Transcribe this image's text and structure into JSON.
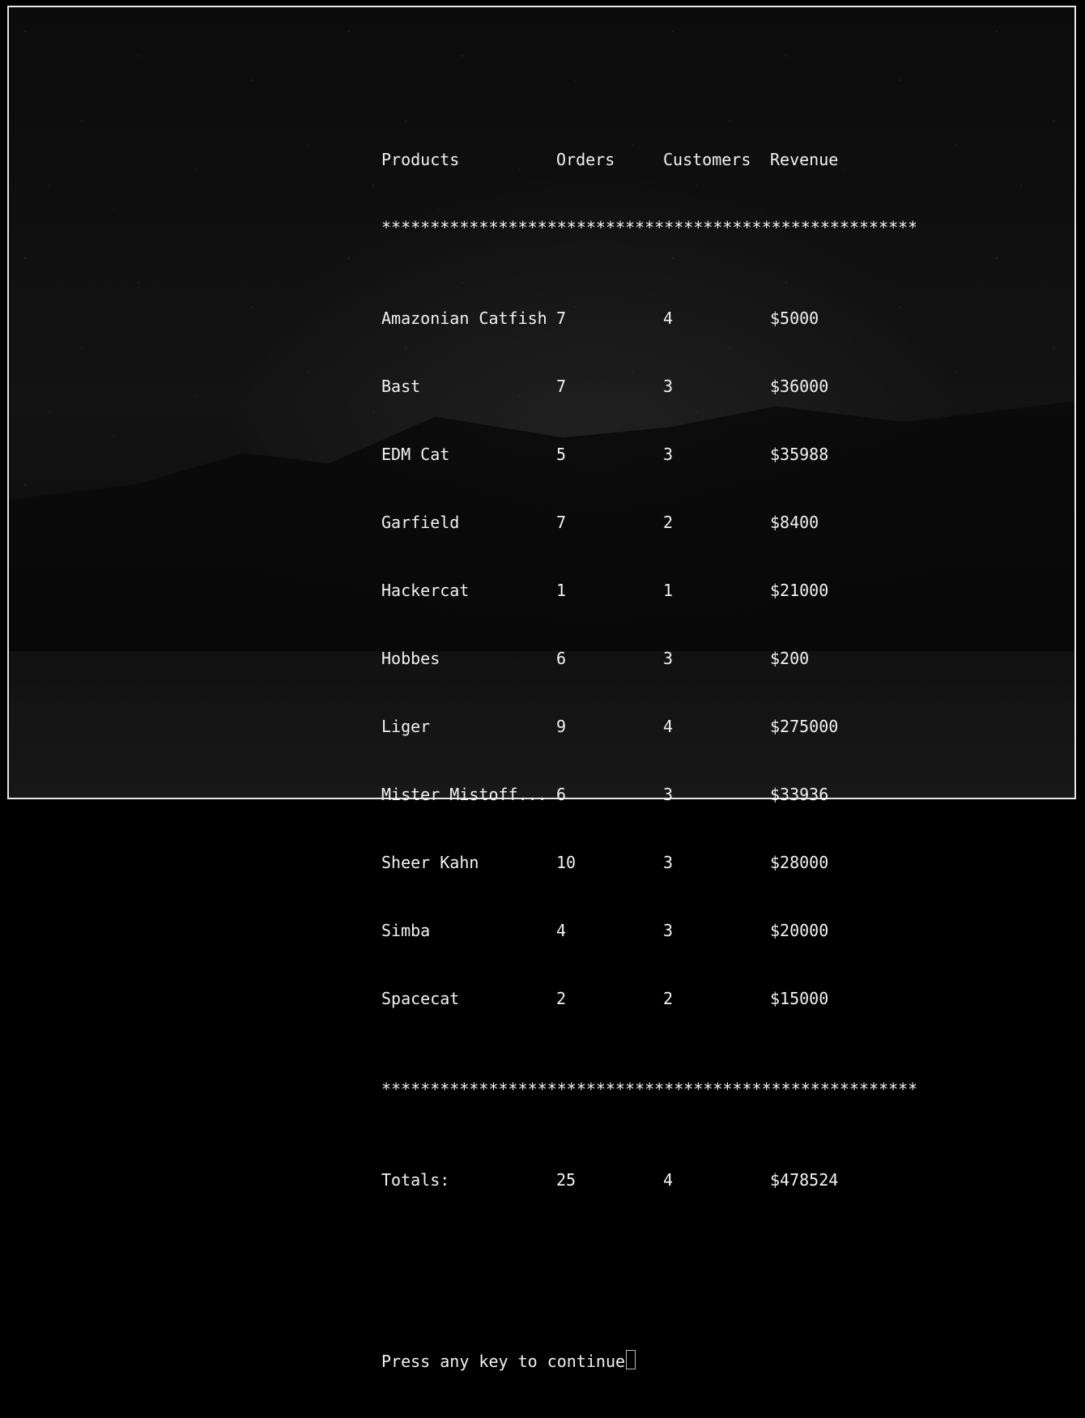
{
  "table": {
    "headers": [
      "Products",
      "Orders",
      "Customers",
      "Revenue"
    ],
    "separator": "*******************************************************",
    "rows": [
      {
        "product": "Amazonian Catfish",
        "orders": "7",
        "customers": "4",
        "revenue": "$5000"
      },
      {
        "product": "Bast",
        "orders": "7",
        "customers": "3",
        "revenue": "$36000"
      },
      {
        "product": "EDM Cat",
        "orders": "5",
        "customers": "3",
        "revenue": "$35988"
      },
      {
        "product": "Garfield",
        "orders": "7",
        "customers": "2",
        "revenue": "$8400"
      },
      {
        "product": "Hackercat",
        "orders": "1",
        "customers": "1",
        "revenue": "$21000"
      },
      {
        "product": "Hobbes",
        "orders": "6",
        "customers": "3",
        "revenue": "$200"
      },
      {
        "product": "Liger",
        "orders": "9",
        "customers": "4",
        "revenue": "$275000"
      },
      {
        "product": "Mister Mistoff...",
        "orders": "6",
        "customers": "3",
        "revenue": "$33936"
      },
      {
        "product": "Sheer Kahn",
        "orders": "10",
        "customers": "3",
        "revenue": "$28000"
      },
      {
        "product": "Simba",
        "orders": "4",
        "customers": "3",
        "revenue": "$20000"
      },
      {
        "product": "Spacecat",
        "orders": "2",
        "customers": "2",
        "revenue": "$15000"
      }
    ],
    "totals": {
      "label": "Totals:",
      "orders": "25",
      "customers": "4",
      "revenue": "$478524"
    }
  },
  "prompt": "Press any key to continue"
}
